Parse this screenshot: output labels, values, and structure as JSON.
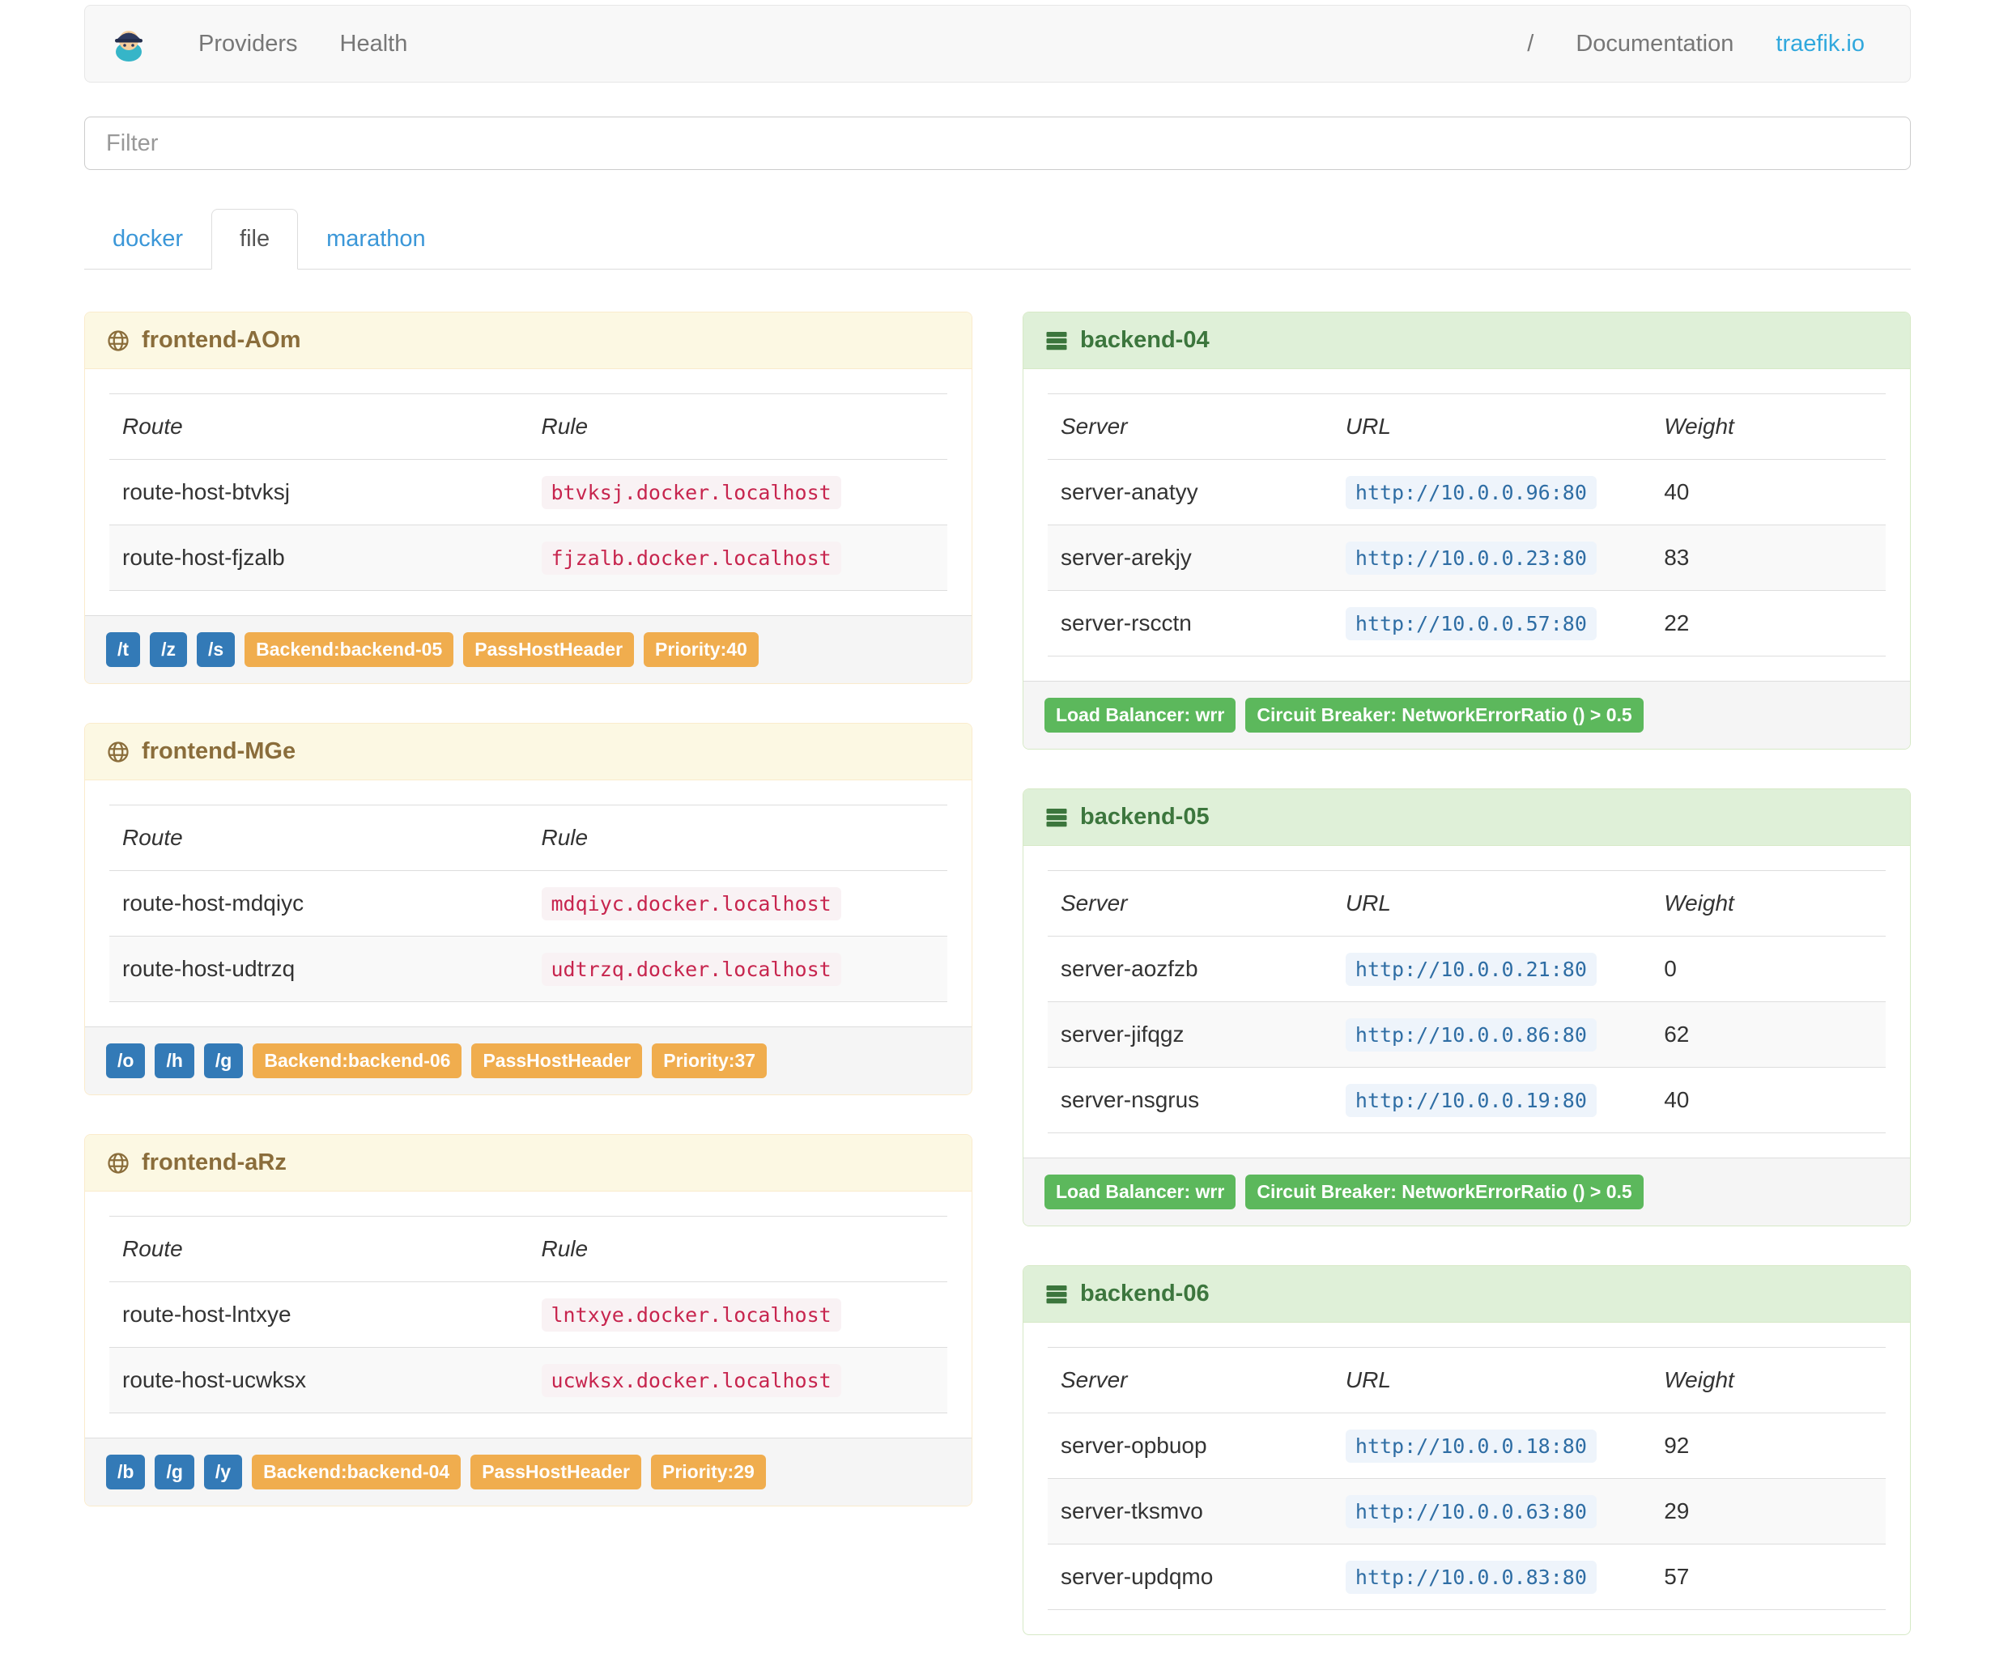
{
  "navbar": {
    "brand_icon": "traefik-logo",
    "links": [
      {
        "label": "Providers"
      },
      {
        "label": "Health"
      }
    ],
    "separator": "/",
    "documentation_label": "Documentation",
    "site_label": "traefik.io"
  },
  "filter": {
    "placeholder": "Filter"
  },
  "tabs": [
    {
      "label": "docker",
      "active": false
    },
    {
      "label": "file",
      "active": true
    },
    {
      "label": "marathon",
      "active": false
    }
  ],
  "frontends": [
    {
      "title": "frontend-AOm",
      "icon": "globe-icon",
      "columns": [
        "Route",
        "Rule"
      ],
      "routes": [
        {
          "route": "route-host-btvksj",
          "rule": "btvksj.docker.localhost"
        },
        {
          "route": "route-host-fjzalb",
          "rule": "fjzalb.docker.localhost"
        }
      ],
      "entry_badges": [
        "/t",
        "/z",
        "/s"
      ],
      "badges": [
        "Backend:backend-05",
        "PassHostHeader",
        "Priority:40"
      ]
    },
    {
      "title": "frontend-MGe",
      "icon": "globe-icon",
      "columns": [
        "Route",
        "Rule"
      ],
      "routes": [
        {
          "route": "route-host-mdqiyc",
          "rule": "mdqiyc.docker.localhost"
        },
        {
          "route": "route-host-udtrzq",
          "rule": "udtrzq.docker.localhost"
        }
      ],
      "entry_badges": [
        "/o",
        "/h",
        "/g"
      ],
      "badges": [
        "Backend:backend-06",
        "PassHostHeader",
        "Priority:37"
      ]
    },
    {
      "title": "frontend-aRz",
      "icon": "globe-icon",
      "columns": [
        "Route",
        "Rule"
      ],
      "routes": [
        {
          "route": "route-host-lntxye",
          "rule": "lntxye.docker.localhost"
        },
        {
          "route": "route-host-ucwksx",
          "rule": "ucwksx.docker.localhost"
        }
      ],
      "entry_badges": [
        "/b",
        "/g",
        "/y"
      ],
      "badges": [
        "Backend:backend-04",
        "PassHostHeader",
        "Priority:29"
      ]
    }
  ],
  "backends": [
    {
      "title": "backend-04",
      "icon": "server-icon",
      "columns": [
        "Server",
        "URL",
        "Weight"
      ],
      "servers": [
        {
          "server": "server-anatyy",
          "url": "http://10.0.0.96:80",
          "weight": "40"
        },
        {
          "server": "server-arekjy",
          "url": "http://10.0.0.23:80",
          "weight": "83"
        },
        {
          "server": "server-rscctn",
          "url": "http://10.0.0.57:80",
          "weight": "22"
        }
      ],
      "badges": [
        "Load Balancer: wrr",
        "Circuit Breaker: NetworkErrorRatio () > 0.5"
      ]
    },
    {
      "title": "backend-05",
      "icon": "server-icon",
      "columns": [
        "Server",
        "URL",
        "Weight"
      ],
      "servers": [
        {
          "server": "server-aozfzb",
          "url": "http://10.0.0.21:80",
          "weight": "0"
        },
        {
          "server": "server-jifqgz",
          "url": "http://10.0.0.86:80",
          "weight": "62"
        },
        {
          "server": "server-nsgrus",
          "url": "http://10.0.0.19:80",
          "weight": "40"
        }
      ],
      "badges": [
        "Load Balancer: wrr",
        "Circuit Breaker: NetworkErrorRatio () > 0.5"
      ]
    },
    {
      "title": "backend-06",
      "icon": "server-icon",
      "columns": [
        "Server",
        "URL",
        "Weight"
      ],
      "servers": [
        {
          "server": "server-opbuop",
          "url": "http://10.0.0.18:80",
          "weight": "92"
        },
        {
          "server": "server-tksmvo",
          "url": "http://10.0.0.63:80",
          "weight": "29"
        },
        {
          "server": "server-updqmo",
          "url": "http://10.0.0.83:80",
          "weight": "57"
        }
      ],
      "badges": []
    }
  ],
  "colors": {
    "frontend_header_bg": "#fcf8e3",
    "frontend_header_text": "#8a6d3b",
    "backend_header_bg": "#dff0d8",
    "backend_header_text": "#3c763d",
    "badge_blue": "#337ab7",
    "badge_orange": "#f0ad4e",
    "badge_green": "#5cb85c",
    "rule_code_color": "#c7254e",
    "url_code_color": "#2e6da4",
    "accent_link": "#31a8dd"
  }
}
